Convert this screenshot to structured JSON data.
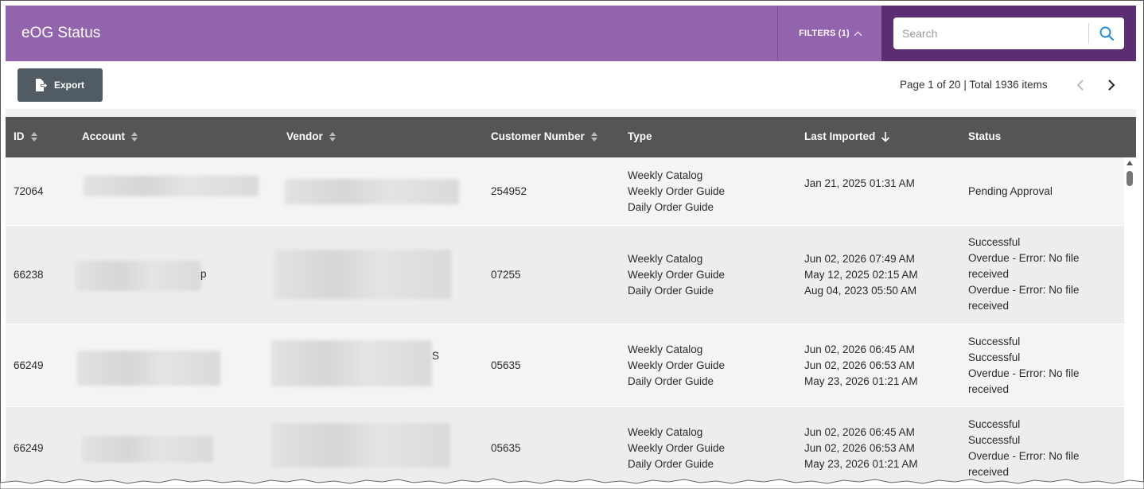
{
  "header": {
    "title": "eOG Status",
    "filters_label": "FILTERS (1)",
    "search_placeholder": "Search"
  },
  "toolbar": {
    "export_label": "Export",
    "page_info": "Page 1 of 20 | Total 1936 items"
  },
  "table": {
    "columns": {
      "id": "ID",
      "account": "Account",
      "vendor": "Vendor",
      "customer_number": "Customer Number",
      "type": "Type",
      "last_imported": "Last Imported",
      "status": "Status"
    },
    "rows": [
      {
        "id": "72064",
        "account_visible": "",
        "vendor_visible": "",
        "customer_number": "254952",
        "type": [
          "Weekly Catalog",
          "Weekly Order Guide",
          "Daily Order Guide"
        ],
        "last_imported": [
          "Jan 21, 2025 01:31 AM"
        ],
        "status": [
          "Pending Approval"
        ]
      },
      {
        "id": "66238",
        "account_visible": "p",
        "vendor_visible": "",
        "customer_number": "07255",
        "type": [
          "Weekly Catalog",
          "Weekly Order Guide",
          "Daily Order Guide"
        ],
        "last_imported": [
          "Jun 02, 2026 07:49 AM",
          "May 12, 2025 02:15 AM",
          "Aug 04, 2023 05:50 AM"
        ],
        "status": [
          "Successful",
          "Overdue - Error: No file",
          "received",
          "Overdue - Error: No file",
          "received"
        ]
      },
      {
        "id": "66249",
        "account_visible": "",
        "vendor_visible": "S",
        "customer_number": "05635",
        "type": [
          "Weekly Catalog",
          "Weekly Order Guide",
          "Daily Order Guide"
        ],
        "last_imported": [
          "Jun 02, 2026 06:45 AM",
          "Jun 02, 2026 06:53 AM",
          "May 23, 2026 01:21 AM"
        ],
        "status": [
          "Successful",
          "Successful",
          "Overdue - Error: No file",
          "received"
        ]
      },
      {
        "id": "66249",
        "account_visible": "",
        "vendor_visible": "",
        "customer_number": "05635",
        "type": [
          "Weekly Catalog",
          "Weekly Order Guide",
          "Daily Order Guide"
        ],
        "last_imported": [
          "Jun 02, 2026 06:45 AM",
          "Jun 02, 2026 06:53 AM",
          "May 23, 2026 01:21 AM"
        ],
        "status": [
          "Successful",
          "Successful",
          "Overdue - Error: No file",
          "received"
        ]
      }
    ]
  },
  "icons": {
    "search": "search-icon",
    "filters_chevron": "chevron-up-icon",
    "export": "export-file-icon",
    "prev": "chevron-left-icon",
    "next": "chevron-right-icon",
    "sort": "sort-icon",
    "sort_desc": "arrow-down-icon"
  },
  "colors": {
    "header": "#9264ae",
    "search_panel": "#5a2e70",
    "table_header": "#555555",
    "export_button": "#505b63",
    "search_icon": "#2a8fd6"
  }
}
